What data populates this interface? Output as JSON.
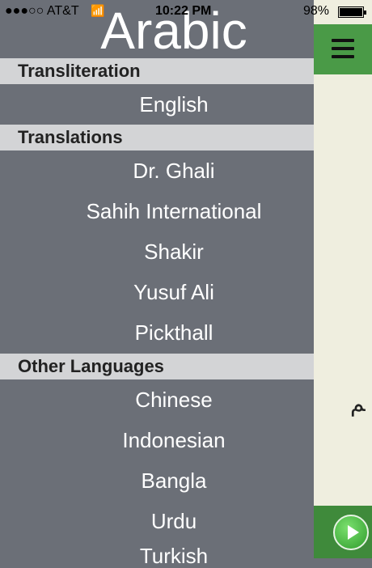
{
  "status_bar": {
    "carrier": "●●●○○ AT&T",
    "time": "10:22 PM",
    "battery_pct": "98%"
  },
  "drawer": {
    "title": "Arabic",
    "sections": [
      {
        "label": "Transliteration",
        "items": [
          "English"
        ]
      },
      {
        "label": "Translations",
        "items": [
          "Dr. Ghali",
          "Sahih International",
          "Shakir",
          "Yusuf Ali",
          "Pickthall"
        ]
      },
      {
        "label": "Other Languages",
        "items": [
          "Chinese",
          "Indonesian",
          "Bangla",
          "Urdu",
          "Turkish"
        ]
      }
    ]
  },
  "main": {
    "arabic_glyph": "ﻢ"
  },
  "icons": {
    "menu": "hamburger-icon",
    "play": "play-icon",
    "wifi": "wifi-icon"
  },
  "colors": {
    "drawer_bg": "#6b6f77",
    "section_bg": "#d3d4d6",
    "topbar": "#4a9a47"
  }
}
